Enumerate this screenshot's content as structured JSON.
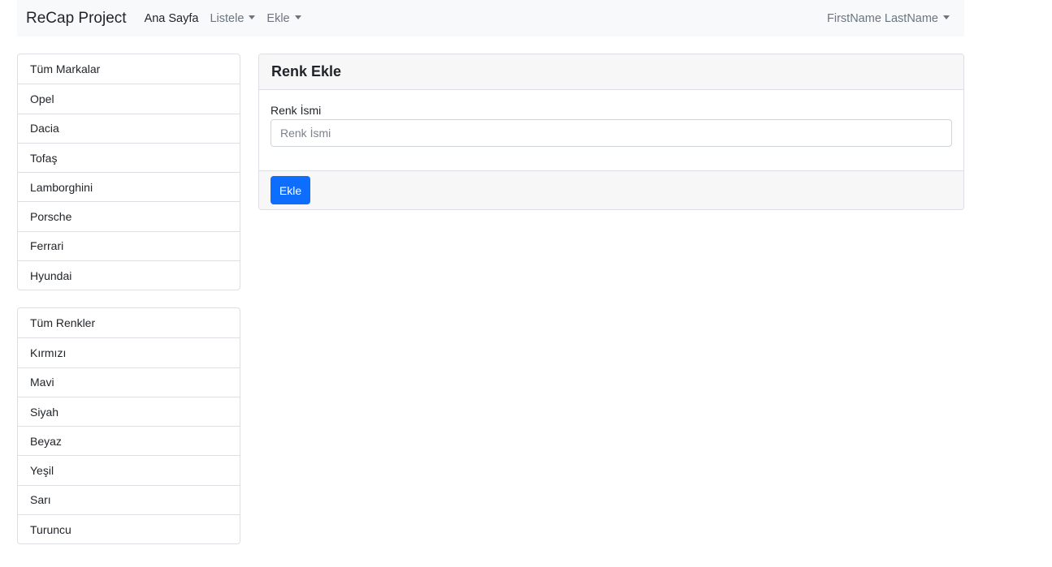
{
  "navbar": {
    "brand": "ReCap Project",
    "links": [
      {
        "label": "Ana Sayfa"
      },
      {
        "label": "Listele"
      },
      {
        "label": "Ekle"
      }
    ],
    "user": "FirstName LastName"
  },
  "brands": {
    "items": [
      "Tüm Markalar",
      "Opel",
      "Dacia",
      "Tofaş",
      "Lamborghini",
      "Porsche",
      "Ferrari",
      "Hyundai"
    ]
  },
  "colors": {
    "items": [
      "Tüm Renkler",
      "Kırmızı",
      "Mavi",
      "Siyah",
      "Beyaz",
      "Yeşil",
      "Sarı",
      "Turuncu"
    ]
  },
  "form": {
    "title": "Renk Ekle",
    "field_label": "Renk İsmi",
    "field_placeholder": "Renk İsmi",
    "field_value": "",
    "submit_label": "Ekle"
  },
  "theme": {
    "primary": "#0d6efd",
    "navbar_bg": "#f8f9fa"
  }
}
